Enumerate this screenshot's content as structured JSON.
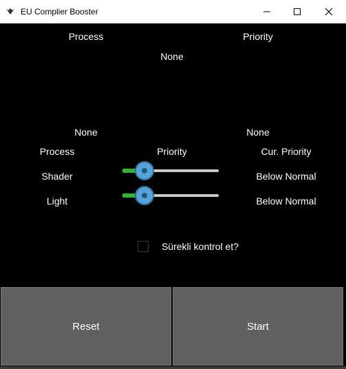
{
  "window": {
    "title": "EU Complier Booster",
    "controls": [
      "minimize-icon",
      "maximize-icon",
      "close-icon"
    ]
  },
  "header": {
    "process_label": "Process",
    "priority_label": "Priority",
    "selected_value": "None"
  },
  "current": {
    "process_value": "None",
    "priority_value": "None"
  },
  "table": {
    "col_process": "Process",
    "col_priority": "Priority",
    "col_cur_priority": "Cur. Priority",
    "rows": [
      {
        "process": "Shader",
        "cur_priority": "Below Normal",
        "slider_fraction": 0.2
      },
      {
        "process": "Light",
        "cur_priority": "Below Normal",
        "slider_fraction": 0.2
      }
    ]
  },
  "checkbox": {
    "label": "Sürekli kontrol et?",
    "checked": false
  },
  "buttons": {
    "reset": "Reset",
    "start": "Start"
  },
  "colors": {
    "slider_fill": "#2fb52f",
    "slider_knob": "#57a3d9",
    "button_bg": "#606060"
  }
}
